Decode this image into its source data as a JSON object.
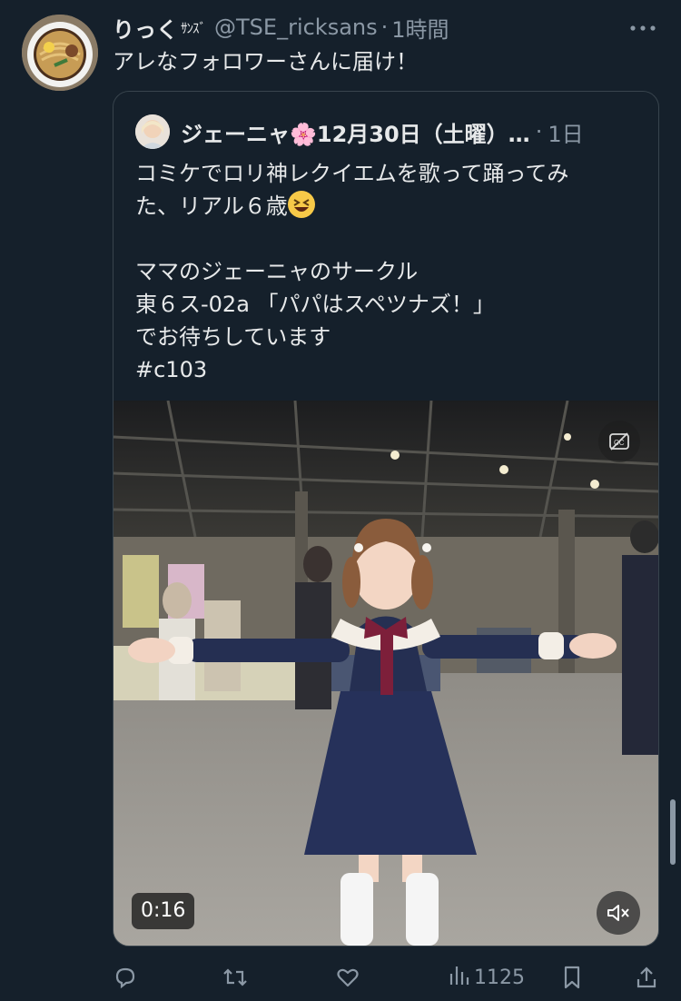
{
  "tweet": {
    "author_name": "りっく",
    "author_badge": "ｻﾝｽﾞ",
    "handle": "@TSE_ricksans",
    "separator": "·",
    "time": "1時間",
    "text": "アレなフォロワーさんに届け！"
  },
  "quote": {
    "author_name": "ジェーニャ🌸12月30日（土曜）…",
    "separator": "·",
    "time": "1日",
    "line1": "コミケでロリ神レクイエムを歌って踊ってみ",
    "line2": "た、リアル６歳",
    "line3": "ママのジェーニャのサークル",
    "line4": "東６ス-02a 「パパはスペツナズ！」",
    "line5": "でお待ちしています",
    "hashtag": "#c103",
    "video": {
      "duration": "0:16"
    }
  },
  "actions": {
    "views_count": "1125"
  },
  "icons": {
    "reply": "reply-icon",
    "retweet": "retweet-icon",
    "like": "like-icon",
    "views": "views-icon",
    "bookmark": "bookmark-icon",
    "share": "share-icon",
    "captions": "captions-off-icon",
    "mute": "muted-speaker-icon",
    "more": "more-icon"
  },
  "colors": {
    "background": "#15202b",
    "text": "#e7e9ea",
    "secondary": "#8b98a5",
    "border": "#38444d"
  }
}
